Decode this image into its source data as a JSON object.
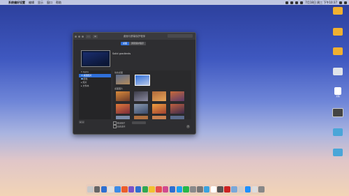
{
  "menubar": {
    "app_name": "系统偏好设置",
    "items": [
      "编辑",
      "显示",
      "窗口",
      "帮助"
    ],
    "clock": "7月18日 周三 下午10:37"
  },
  "window": {
    "title": "桌面与屏幕保护程序",
    "tabs": [
      "桌面",
      "屏幕保护程序"
    ],
    "wallpaper_name": "Solid gradients",
    "sidebar": {
      "items": [
        {
          "label": "▾ Apple",
          "selected": false
        },
        {
          "label": "桌面图片",
          "selected": true
        },
        {
          "label": "颜色",
          "selected": false
        },
        {
          "label": "▸ 照片",
          "selected": false
        },
        {
          "label": "▸ 文件夹",
          "selected": false
        }
      ]
    },
    "section_dynamic": "动态桌面",
    "section_pictures": "桌面图片",
    "options": [
      "更改图片",
      "随机顺序"
    ],
    "add_button": "+ −",
    "help": "?"
  },
  "desktop_icons": [
    {
      "label": "",
      "color": "#f0b030"
    },
    {
      "label": "",
      "color": "#f0b030"
    },
    {
      "label": "",
      "color": "#f0b030"
    },
    {
      "label": "",
      "color": "#dfe3ea"
    },
    {
      "label": "文稿",
      "color": "#ffffff"
    },
    {
      "label": "",
      "color": "#444444"
    },
    {
      "label": "",
      "color": "#4aa6d8"
    },
    {
      "label": "",
      "color": "#4aa6d8"
    }
  ],
  "dock_colors": [
    "#c8c8c8",
    "#666",
    "#2d6fd1",
    "#e0e0e0",
    "#3c8be6",
    "#eb5d2b",
    "#7b52c7",
    "#2d6fd1",
    "#2fa852",
    "#f2c230",
    "#e74f4f",
    "#d24a8e",
    "#2d6fd1",
    "#1da1f2",
    "#25b84a",
    "#8a8a8a",
    "#777",
    "#39a3e0",
    "#ffffff",
    "#555",
    "#c22",
    "#7aa8d9",
    "#ccc",
    "#1e90ff",
    "#ddd",
    "#888"
  ]
}
